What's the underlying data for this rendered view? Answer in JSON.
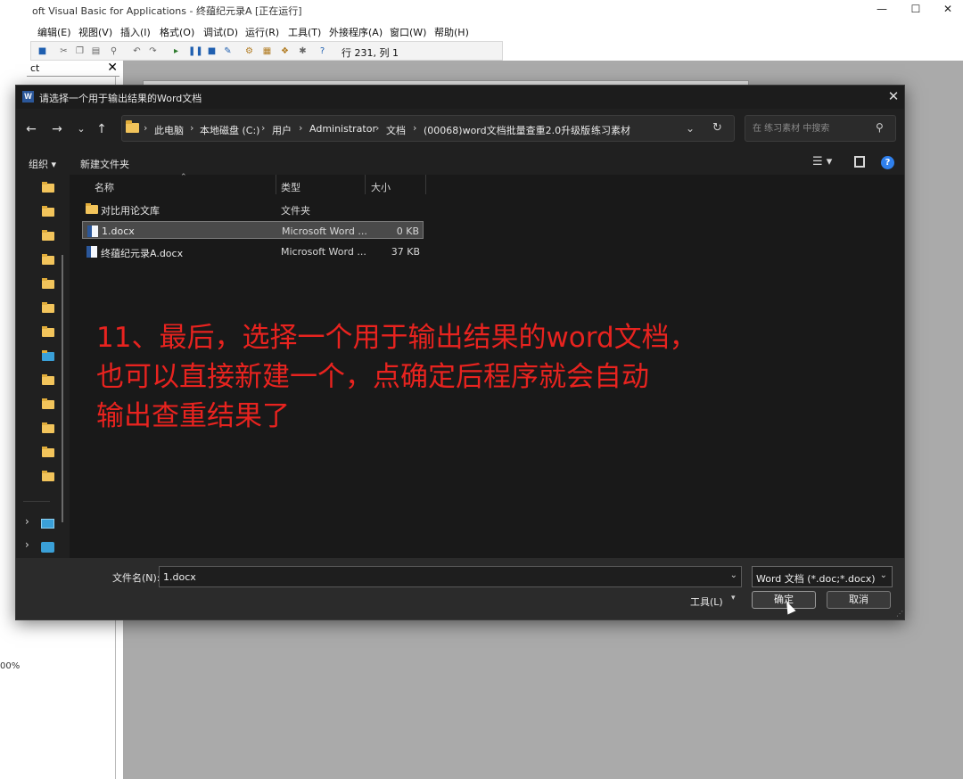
{
  "vba": {
    "title": "oft Visual Basic for Applications - 终蕴纪元录A [正在运行]",
    "menu": [
      "编辑(E)",
      "视图(V)",
      "插入(I)",
      "格式(O)",
      "调试(D)",
      "运行(R)",
      "工具(T)",
      "外接程序(A)",
      "窗口(W)",
      "帮助(H)"
    ],
    "toolbar_position": "行 231, 列 1",
    "panel_title": "ct",
    "zoom": "00%"
  },
  "dialog": {
    "title": "请选择一个用于输出结果的Word文档",
    "breadcrumbs": [
      "此电脑",
      "本地磁盘 (C:)",
      "用户",
      "Administrator",
      "文档",
      "(00068)word文档批量查重2.0升级版",
      "练习素材"
    ],
    "search_placeholder": "在 练习素材 中搜索",
    "organize_label": "组织 ▾",
    "new_folder_label": "新建文件夹",
    "columns": {
      "name": "名称",
      "type": "类型",
      "size": "大小"
    },
    "files": [
      {
        "name": "对比用论文库",
        "type": "文件夹",
        "size": "",
        "icon": "folder-icon",
        "selected": false
      },
      {
        "name": "1.docx",
        "type": "Microsoft Word ...",
        "size": "0 KB",
        "icon": "word-doc-icon",
        "selected": true
      },
      {
        "name": "终蕴纪元录A.docx",
        "type": "Microsoft Word ...",
        "size": "37 KB",
        "icon": "word-doc-icon",
        "selected": false
      }
    ],
    "filename_label": "文件名(N):",
    "filename_value": "1.docx",
    "filetype_value": "Word 文档 (*.doc;*.docx)",
    "tools_label": "工具(L)",
    "ok_label": "确定",
    "cancel_label": "取消"
  },
  "annotation": {
    "lines": [
      "11、最后，选择一个用于输出结果的word文档，",
      "也可以直接新建一个，点确定后程序就会自动",
      "输出查重结果了"
    ],
    "color": "#e8231f"
  }
}
